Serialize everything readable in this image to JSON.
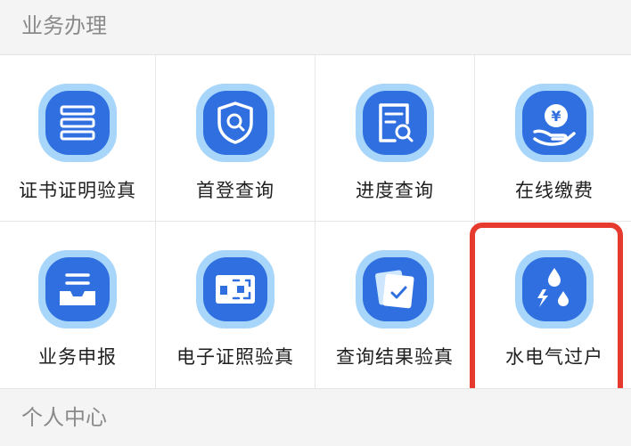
{
  "sections": {
    "business": "业务办理",
    "personal": "个人中心"
  },
  "items": [
    {
      "label": "证书证明验真",
      "icon": "certificate-list-icon"
    },
    {
      "label": "首登查询",
      "icon": "shield-search-icon"
    },
    {
      "label": "进度查询",
      "icon": "document-search-icon"
    },
    {
      "label": "在线缴费",
      "icon": "yuan-payment-icon"
    },
    {
      "label": "业务申报",
      "icon": "inbox-tray-icon"
    },
    {
      "label": "电子证照验真",
      "icon": "scan-frame-icon"
    },
    {
      "label": "查询结果验真",
      "icon": "check-card-icon"
    },
    {
      "label": "水电气过户",
      "icon": "water-electric-icon"
    }
  ],
  "colors": {
    "icon_outer": "#a8d6fb",
    "icon_inner": "#2f6fe0",
    "highlight": "#e63a2e"
  }
}
